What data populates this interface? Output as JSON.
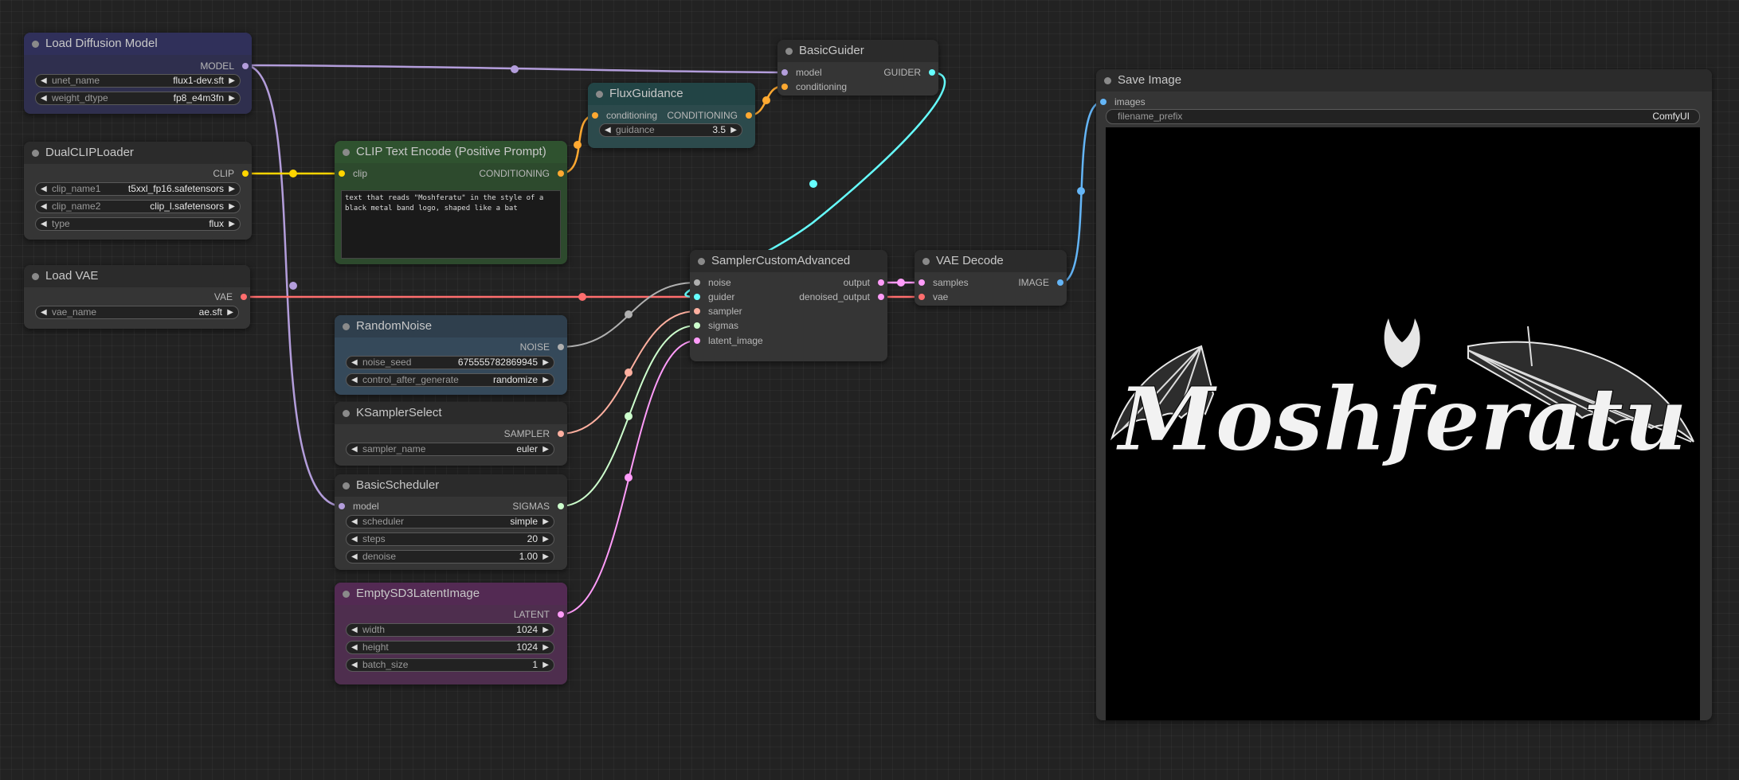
{
  "colors": {
    "model": "#b39ddb",
    "clip": "#ffd500",
    "vae": "#ff6e6e",
    "conditioning": "#ffa931",
    "guider": "#66ffff",
    "noise": "#b0b0b0",
    "sampler": "#ffb0a0",
    "sigmas": "#cdffcd",
    "latent": "#ff9cf9",
    "image": "#64b5f6"
  },
  "nodes": {
    "load_diffusion_model": {
      "title": "Load Diffusion Model",
      "output": "MODEL",
      "widgets": [
        {
          "label": "unet_name",
          "value": "flux1-dev.sft"
        },
        {
          "label": "weight_dtype",
          "value": "fp8_e4m3fn"
        }
      ]
    },
    "dual_clip_loader": {
      "title": "DualCLIPLoader",
      "output": "CLIP",
      "widgets": [
        {
          "label": "clip_name1",
          "value": "t5xxl_fp16.safetensors"
        },
        {
          "label": "clip_name2",
          "value": "clip_l.safetensors"
        },
        {
          "label": "type",
          "value": "flux"
        }
      ]
    },
    "load_vae": {
      "title": "Load VAE",
      "output": "VAE",
      "widgets": [
        {
          "label": "vae_name",
          "value": "ae.sft"
        }
      ]
    },
    "clip_text_encode": {
      "title": "CLIP Text Encode (Positive Prompt)",
      "input": "clip",
      "output": "CONDITIONING",
      "text": "text that reads \"Moshferatu\" in the style of a black metal band logo, shaped like a bat"
    },
    "flux_guidance": {
      "title": "FluxGuidance",
      "input": "conditioning",
      "output": "CONDITIONING",
      "widgets": [
        {
          "label": "guidance",
          "value": "3.5"
        }
      ]
    },
    "basic_guider": {
      "title": "BasicGuider",
      "inputs": [
        "model",
        "conditioning"
      ],
      "output": "GUIDER"
    },
    "random_noise": {
      "title": "RandomNoise",
      "output": "NOISE",
      "widgets": [
        {
          "label": "noise_seed",
          "value": "675555782869945"
        },
        {
          "label": "control_after_generate",
          "value": "randomize"
        }
      ]
    },
    "ksampler_select": {
      "title": "KSamplerSelect",
      "output": "SAMPLER",
      "widgets": [
        {
          "label": "sampler_name",
          "value": "euler"
        }
      ]
    },
    "basic_scheduler": {
      "title": "BasicScheduler",
      "input": "model",
      "output": "SIGMAS",
      "widgets": [
        {
          "label": "scheduler",
          "value": "simple"
        },
        {
          "label": "steps",
          "value": "20"
        },
        {
          "label": "denoise",
          "value": "1.00"
        }
      ]
    },
    "empty_latent": {
      "title": "EmptySD3LatentImage",
      "output": "LATENT",
      "widgets": [
        {
          "label": "width",
          "value": "1024"
        },
        {
          "label": "height",
          "value": "1024"
        },
        {
          "label": "batch_size",
          "value": "1"
        }
      ]
    },
    "sampler_custom_advanced": {
      "title": "SamplerCustomAdvanced",
      "inputs": [
        "noise",
        "guider",
        "sampler",
        "sigmas",
        "latent_image"
      ],
      "outputs": [
        "output",
        "denoised_output"
      ]
    },
    "vae_decode": {
      "title": "VAE Decode",
      "inputs": [
        "samples",
        "vae"
      ],
      "output": "IMAGE"
    },
    "save_image": {
      "title": "Save Image",
      "input": "images",
      "prefix_label": "filename_prefix",
      "prefix_value": "ComfyUI",
      "preview_text": "Moshferatu"
    }
  }
}
